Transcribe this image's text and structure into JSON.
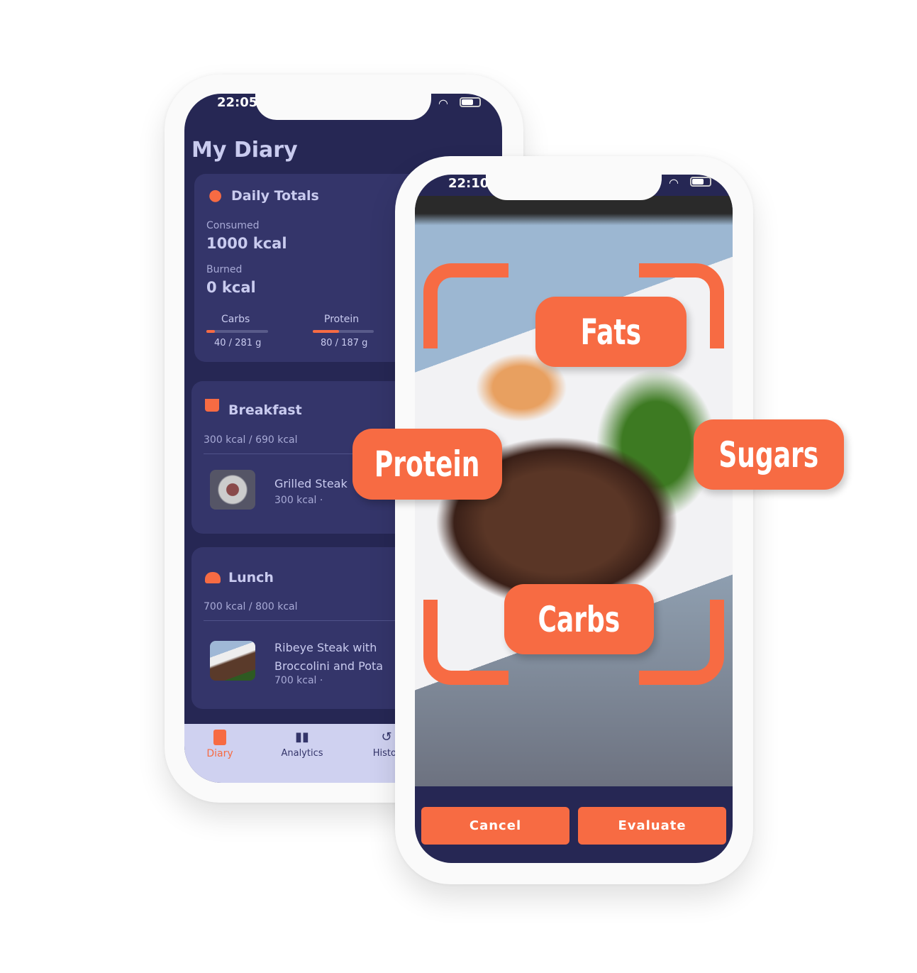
{
  "back_phone": {
    "status_time": "22:05",
    "title": "My Diary",
    "daily_totals": {
      "heading": "Daily Totals",
      "consumed_label": "Consumed",
      "consumed_value": "1000 kcal",
      "burned_label": "Burned",
      "burned_value": "0 kcal",
      "macros": [
        {
          "label": "Carbs",
          "value": "40 / 281 g",
          "progress": 0.14
        },
        {
          "label": "Protein",
          "value": "80 / 187 g",
          "progress": 0.43
        }
      ]
    },
    "meals": [
      {
        "name": "Breakfast",
        "kcal": "300 kcal / 690 kcal",
        "items": [
          {
            "name": "Grilled Steak",
            "kcal": "300 kcal ·"
          }
        ]
      },
      {
        "name": "Lunch",
        "kcal": "700 kcal / 800 kcal",
        "items": [
          {
            "name": "Ribeye Steak with",
            "name2": "Broccolini and Pota",
            "kcal": "700 kcal ·"
          }
        ]
      }
    ],
    "nav": [
      {
        "label": "Diary",
        "active": true
      },
      {
        "label": "Analytics"
      },
      {
        "label": "Histor"
      }
    ]
  },
  "front_phone": {
    "status_time": "22:10",
    "labels": {
      "fats": "Fats",
      "protein": "Protein",
      "sugars": "Sugars",
      "carbs": "Carbs"
    },
    "cancel": "Cancel",
    "evaluate": "Evaluate"
  },
  "colors": {
    "accent": "#f76b43",
    "navy": "#262754",
    "card": "#34356a",
    "nav": "#cfd1f0"
  }
}
